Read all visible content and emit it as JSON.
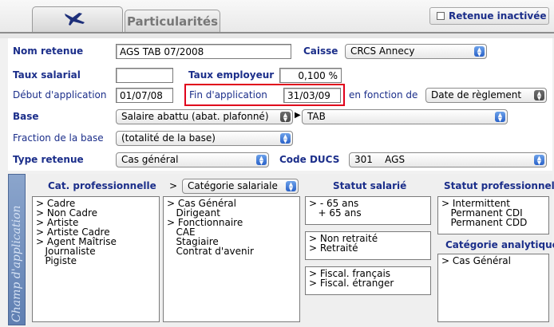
{
  "header": {
    "tab_particularites": "Particularités",
    "retenue_inactive": "Retenue inactivée"
  },
  "form": {
    "nom_retenue_label": "Nom retenue",
    "nom_retenue_value": "AGS TAB 07/2008",
    "caisse_label": "Caisse",
    "caisse_value": "CRCS Annecy",
    "taux_salarial_label": "Taux salarial",
    "taux_salarial_value": "",
    "taux_employeur_label": "Taux employeur",
    "taux_employeur_value": "0,100 %",
    "debut_label": "Début d'application",
    "debut_value": "01/07/08",
    "fin_label": "Fin d'application",
    "fin_value": "31/03/09",
    "en_fonction_label": "en fonction de",
    "en_fonction_value": "Date de règlement",
    "base_label": "Base",
    "base_value": "Salaire abattu (abat. plafonné)",
    "base_sub_value": "TAB",
    "fraction_label": "Fraction de la base",
    "fraction_value": "(totalité de la base)",
    "type_retenue_label": "Type retenue",
    "type_retenue_value": "Cas général",
    "code_ducs_label": "Code DUCS",
    "code_ducs_value": "301    AGS"
  },
  "champ": {
    "side_label": "Champ d'application",
    "cat_pro_header": "Cat. professionnelle",
    "cat_pro_items": [
      "> Cadre",
      "> Non Cadre",
      "> Artiste",
      "> Artiste Cadre",
      "> Agent Maîtrise",
      "   Journaliste",
      "   Pigiste"
    ],
    "cat_sal_prefix": ">",
    "cat_sal_select": "Catégorie salariale",
    "cat_sal_items": [
      "> Cas Général",
      "   Dirigeant",
      "> Fonctionnaire",
      "   CAE",
      "   Stagiaire",
      "   Contrat d'avenir"
    ],
    "statut_sal_header": "Statut salarié",
    "statut_sal_age": [
      "> - 65 ans",
      "   + 65 ans"
    ],
    "statut_sal_retraite": [
      "> Non retraité",
      "> Retraité"
    ],
    "statut_sal_fiscal": [
      "> Fiscal. français",
      "> Fiscal. étranger"
    ],
    "statut_pro_header": "Statut professionnel",
    "statut_pro_items": [
      "> Intermittent",
      "   Permanent CDI",
      "   Permanent CDD"
    ],
    "cat_analytique_header": "Catégorie analytique",
    "cat_analytique_items": [
      "> Cas Général"
    ]
  }
}
